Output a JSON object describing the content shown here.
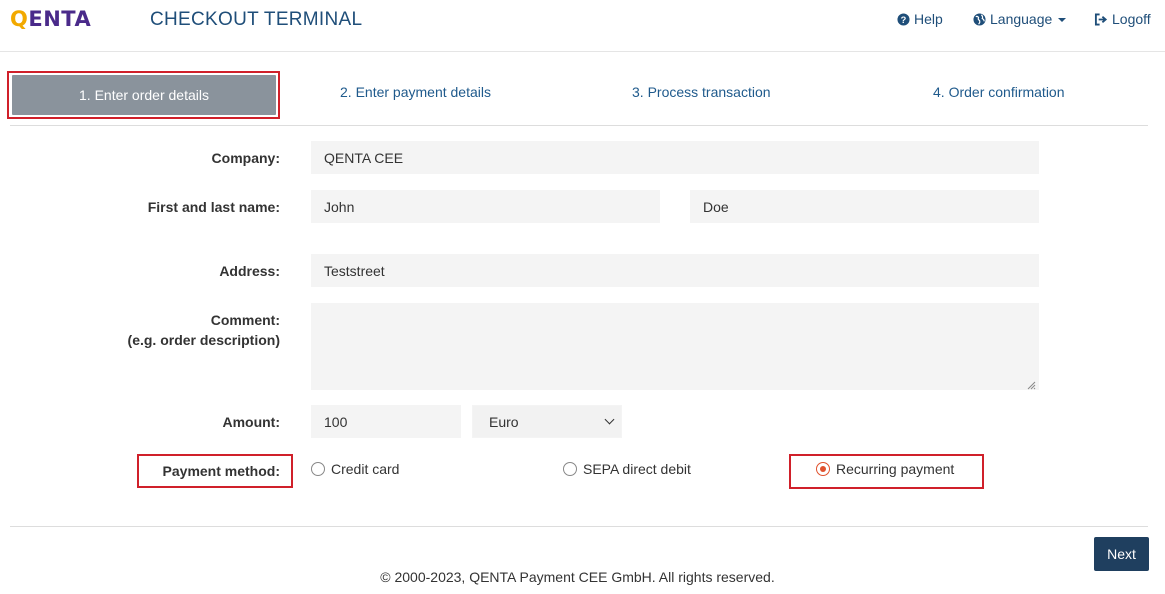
{
  "header": {
    "logo_q": "Q",
    "logo_rest": "ENTA",
    "title": "CHECKOUT TERMINAL",
    "nav": {
      "help": "Help",
      "language": "Language",
      "logoff": "Logoff"
    }
  },
  "steps": [
    {
      "label": "1. Enter order details",
      "active": true
    },
    {
      "label": "2. Enter payment details",
      "active": false
    },
    {
      "label": "3. Process transaction",
      "active": false
    },
    {
      "label": "4. Order confirmation",
      "active": false
    }
  ],
  "form": {
    "company": {
      "label": "Company:",
      "value": "QENTA CEE"
    },
    "name": {
      "label": "First and last name:",
      "first": "John",
      "last": "Doe"
    },
    "address": {
      "label": "Address:",
      "value": "Teststreet"
    },
    "comment": {
      "label_line1": "Comment:",
      "label_line2": "(e.g. order description)",
      "value": ""
    },
    "amount": {
      "label": "Amount:",
      "value": "100",
      "currency": "Euro"
    },
    "payment_method": {
      "label": "Payment method:",
      "options": [
        {
          "label": "Credit card",
          "selected": false
        },
        {
          "label": "SEPA direct debit",
          "selected": false
        },
        {
          "label": "Recurring payment",
          "selected": true
        }
      ]
    }
  },
  "actions": {
    "next": "Next"
  },
  "footer": {
    "copyright": "© 2000-2023, QENTA Payment CEE GmbH. All rights reserved."
  },
  "colors": {
    "accent": "#1f4e79",
    "highlight_border": "#d0202a",
    "radio_selected": "#e0522e",
    "step_active_bg": "#8a939c",
    "button_bg": "#1f3f5f"
  },
  "icons": {
    "help": "question-circle-icon",
    "language": "globe-icon",
    "logoff": "sign-out-icon"
  }
}
